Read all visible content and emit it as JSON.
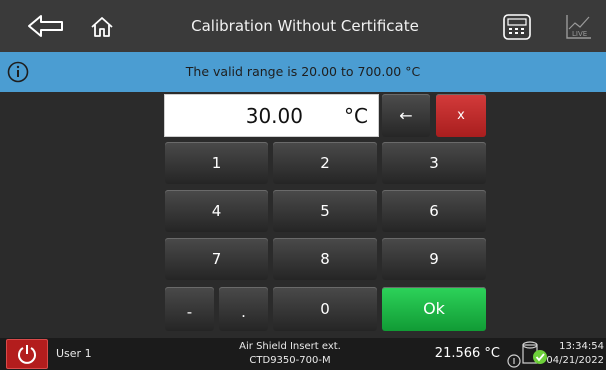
{
  "header": {
    "title": "Calibration Without Certificate",
    "icons": [
      "back-arrow-icon",
      "home-icon",
      "calculator-icon",
      "live-chart-icon"
    ],
    "live_label": "LIVE"
  },
  "info": {
    "message": "The valid range is 20.00 to 700.00 °C",
    "icon": "info-icon"
  },
  "entry": {
    "value": "30.00",
    "unit": "°C"
  },
  "keypad": {
    "backspace": "←",
    "clear": "x",
    "rows": [
      [
        "1",
        "2",
        "3"
      ],
      [
        "4",
        "5",
        "6"
      ],
      [
        "7",
        "8",
        "9"
      ]
    ],
    "minus": "-",
    "dot": ".",
    "zero": "0",
    "ok": "Ok"
  },
  "status": {
    "user": "User 1",
    "probe_line1": "Air Shield Insert ext.",
    "probe_line2": "CTD9350-700-M",
    "temperature": "21.566 °C",
    "time": "13:34:54",
    "date": "04/21/2022"
  },
  "colors": {
    "info_bar": "#4b9dd2",
    "clear_key": "#c32626",
    "ok_key": "#1fbf47",
    "power_button": "#b31d1d"
  }
}
